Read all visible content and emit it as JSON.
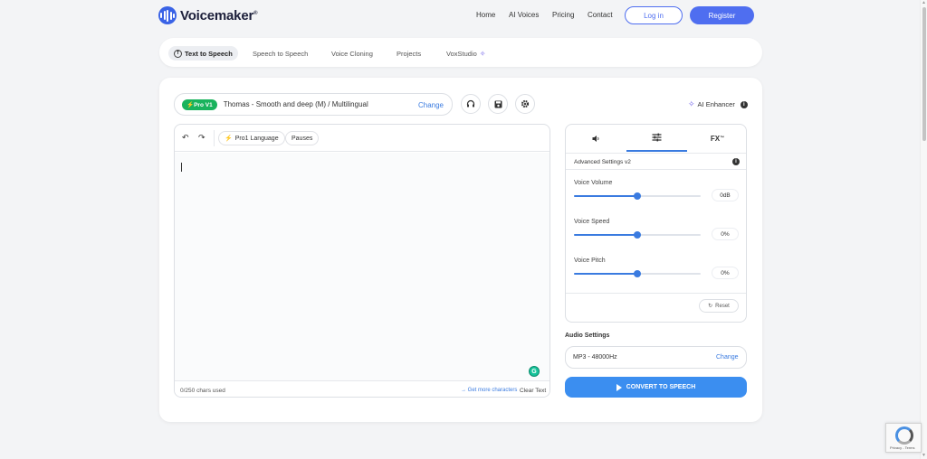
{
  "header": {
    "brand": "Voicemaker",
    "brand_mark": "®",
    "nav": [
      "Home",
      "AI Voices",
      "Pricing",
      "Contact"
    ],
    "login_label": "Log in",
    "register_label": "Register"
  },
  "tabs": [
    {
      "label": "Text to Speech",
      "active": true
    },
    {
      "label": "Speech to Speech",
      "active": false
    },
    {
      "label": "Voice Cloning",
      "active": false
    },
    {
      "label": "Projects",
      "active": false
    },
    {
      "label": "VoxStudio",
      "active": false
    }
  ],
  "voice_selector": {
    "badge": "Pro V1",
    "voice": "Thomas - Smooth and deep (M) / Multilingual",
    "change_label": "Change"
  },
  "ai_enhancer_label": "AI Enhancer",
  "editor": {
    "pro_language_label": "Pro1 Language",
    "pauses_label": "Pauses",
    "chars_used": "0/250 chars used",
    "get_more_label": "Get more characters",
    "clear_text_label": "Clear Text"
  },
  "settings": {
    "fx_label": "FX",
    "fx_mark": "™",
    "header": "Advanced Settings v2",
    "sliders": [
      {
        "label": "Voice Volume",
        "value": "0dB",
        "level": 0.5
      },
      {
        "label": "Voice Speed",
        "value": "0%",
        "level": 0.5
      },
      {
        "label": "Voice Pitch",
        "value": "0%",
        "level": 0.5
      }
    ],
    "reset_label": "Reset"
  },
  "audio": {
    "title": "Audio Settings",
    "format": "MP3 - 48000Hz",
    "change_label": "Change"
  },
  "convert_label": "CONVERT TO SPEECH",
  "recaptcha_text": "Privacy - Terms",
  "colors": {
    "brand": "#3a63e6",
    "accent": "#3a7be0",
    "pro_badge": "#19b35d"
  }
}
